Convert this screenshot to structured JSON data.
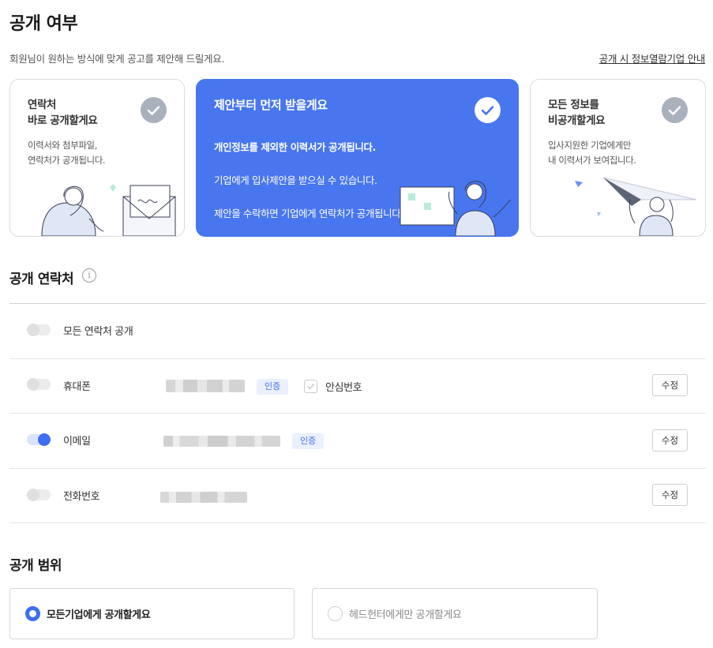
{
  "page": {
    "title": "공개 여부",
    "subtitle": "회원님이 원하는 방식에 맞게 공고를 제안해 드릴게요.",
    "info_link": "공개 시 정보열람기업 안내"
  },
  "options": [
    {
      "title": "연락처\n바로 공개할게요",
      "desc": "이력서와 첨부파일,\n연락처가 공개됩니다.",
      "selected": false,
      "check_icon": "check-circle-icon"
    },
    {
      "title": "제안부터 먼저 받을게요",
      "desc_lines": [
        "개인정보를 제외한 이력서가 공개됩니다.",
        "기업에게 입사제안을 받으실 수 있습니다.",
        "제안을 수락하면 기업에게 연락처가 공개됩니다."
      ],
      "selected": true,
      "check_icon": "check-circle-icon"
    },
    {
      "title": "모든 정보를\n비공개할게요",
      "desc": "입사지원한 기업에게만\n내 이력서가 보여집니다.",
      "selected": false,
      "check_icon": "check-circle-icon"
    }
  ],
  "contacts": {
    "title": "공개 연락처",
    "info_icon": "info-icon",
    "rows": [
      {
        "label": "모든 연락처 공개",
        "enabled": false
      },
      {
        "label": "휴대폰",
        "enabled": false,
        "badge": "인증",
        "safe_number_label": "안심번호",
        "safe_number_checked": false,
        "edit_label": "수정"
      },
      {
        "label": "이메일",
        "enabled": true,
        "badge": "인증",
        "edit_label": "수정"
      },
      {
        "label": "전화번호",
        "enabled": false,
        "edit_label": "수정"
      }
    ]
  },
  "scope": {
    "title": "공개 범위",
    "options": [
      {
        "label": "모든기업에게 공개할게요",
        "selected": true
      },
      {
        "label": "헤드헌터에게만 공개할게요",
        "selected": false
      }
    ]
  },
  "colors": {
    "accent": "#4876ef",
    "toggle_on": "#3f6ff0",
    "badge_bg": "#eaf0fe",
    "check_inactive": "#a9b1bd"
  }
}
